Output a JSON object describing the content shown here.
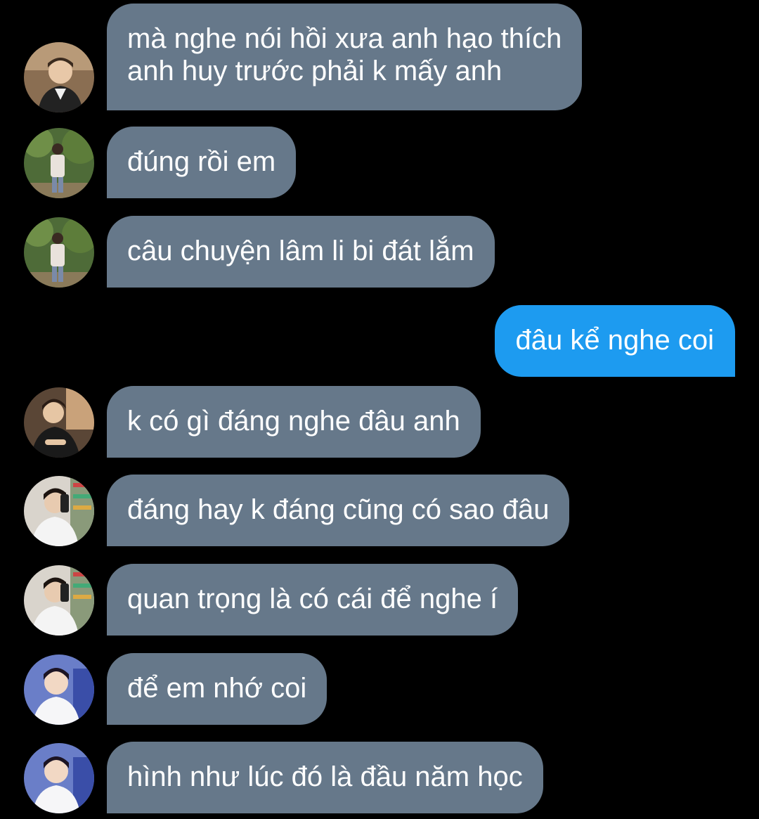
{
  "colors": {
    "background": "#000000",
    "incoming_bubble": "#66788a",
    "outgoing_bubble": "#1d9bf0",
    "text": "#ffffff"
  },
  "messages": [
    {
      "direction": "incoming",
      "lines": [
        "mà nghe nói hồi xưa anh hạo thích",
        "anh huy trước phải k mấy anh"
      ],
      "avatar": "avatar-icon"
    },
    {
      "direction": "incoming",
      "lines": [
        "đúng rồi em"
      ],
      "avatar": "avatar-icon"
    },
    {
      "direction": "incoming",
      "lines": [
        "câu chuyện lâm li bi đát lắm"
      ],
      "avatar": "avatar-icon"
    },
    {
      "direction": "outgoing",
      "lines": [
        "đâu kể nghe coi"
      ]
    },
    {
      "direction": "incoming",
      "lines": [
        "k có gì đáng nghe đâu anh"
      ],
      "avatar": "avatar-icon"
    },
    {
      "direction": "incoming",
      "lines": [
        "đáng hay k đáng cũng có sao đâu"
      ],
      "avatar": "avatar-icon"
    },
    {
      "direction": "incoming",
      "lines": [
        "quan trọng là có cái để nghe í"
      ],
      "avatar": "avatar-icon"
    },
    {
      "direction": "incoming",
      "lines": [
        "để em nhớ coi"
      ],
      "avatar": "avatar-icon"
    },
    {
      "direction": "incoming",
      "lines": [
        "hình như lúc đó là đầu năm học"
      ],
      "avatar": "avatar-icon"
    }
  ]
}
